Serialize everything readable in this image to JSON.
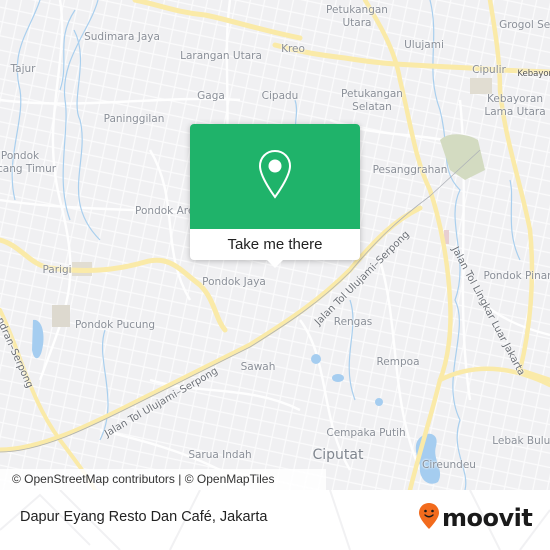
{
  "map": {
    "places": [
      {
        "id": "sudimara-jaya",
        "label": "Sudimara Jaya"
      },
      {
        "id": "larangan-utara",
        "label": "Larangan Utara"
      },
      {
        "id": "tajur",
        "label": "Tajur"
      },
      {
        "id": "gaga",
        "label": "Gaga"
      },
      {
        "id": "cipadu",
        "label": "Cipadu"
      },
      {
        "id": "kreo",
        "label": "Kreo"
      },
      {
        "id": "paninggilan",
        "label": "Paninggilan"
      },
      {
        "id": "pondok-aren",
        "label": "Pondok Aren"
      },
      {
        "id": "pondok-cabe-timur",
        "label": "Pondok\nKacang Timur"
      },
      {
        "id": "parigi",
        "label": "Parigi"
      },
      {
        "id": "pondok-jaya",
        "label": "Pondok Jaya"
      },
      {
        "id": "pondok-pucung",
        "label": "Pondok Pucung"
      },
      {
        "id": "sawah",
        "label": "Sawah"
      },
      {
        "id": "rengas",
        "label": "Rengas"
      },
      {
        "id": "rempoa",
        "label": "Rempoa"
      },
      {
        "id": "sarua-indah",
        "label": "Sarua Indah"
      },
      {
        "id": "cempaka-putih",
        "label": "Cempaka Putih"
      },
      {
        "id": "ciputat",
        "label": "Ciputat"
      },
      {
        "id": "cireundeu",
        "label": "Cireundeu"
      },
      {
        "id": "lebak-bulus",
        "label": "Lebak Bulus"
      },
      {
        "id": "pondok-pinang",
        "label": "Pondok Pinang"
      },
      {
        "id": "pesanggrahan",
        "label": "Pesanggrahan"
      },
      {
        "id": "petukangan-utara",
        "label": "Petukangan\nUtara"
      },
      {
        "id": "petukangan-selatan",
        "label": "Petukangan\nSelatan"
      },
      {
        "id": "ulujami",
        "label": "Ulujami"
      },
      {
        "id": "cipulir",
        "label": "Cipulir"
      },
      {
        "id": "grogol-selatan",
        "label": "Grogol Selatan"
      },
      {
        "id": "kebayoran-lama-utara",
        "label": "Kebayoran\nLama Utara"
      },
      {
        "id": "kebayoran",
        "label": "Kebayoran"
      }
    ],
    "roads": [
      {
        "id": "tol-ulujami-serpong",
        "label": "Jalan Tol Ulujami–Serpong"
      },
      {
        "id": "tol-ulujami-serpong-2",
        "label": "Jalan Tol Ulujami–Serpong"
      },
      {
        "id": "tol-lingkar-luar",
        "label": "Jalan Tol Lingkar Luar Jakarta"
      },
      {
        "id": "pondok-ranji-serpong",
        "label": "Jalan Tol Pondok Aren–Serpong"
      }
    ],
    "road_partials": {
      "serpong_edge": "ndran–Serpong"
    }
  },
  "popup": {
    "icon": "map-pin-icon",
    "button_label": "Take me there",
    "accent_color": "#1fb36a"
  },
  "attribution": "© OpenStreetMap contributors | © OpenMapTiles",
  "footer": {
    "title": "Dapur Eyang Resto Dan Café, Jakarta",
    "logo_text": "moovit",
    "logo_color": "#f26b1d"
  }
}
